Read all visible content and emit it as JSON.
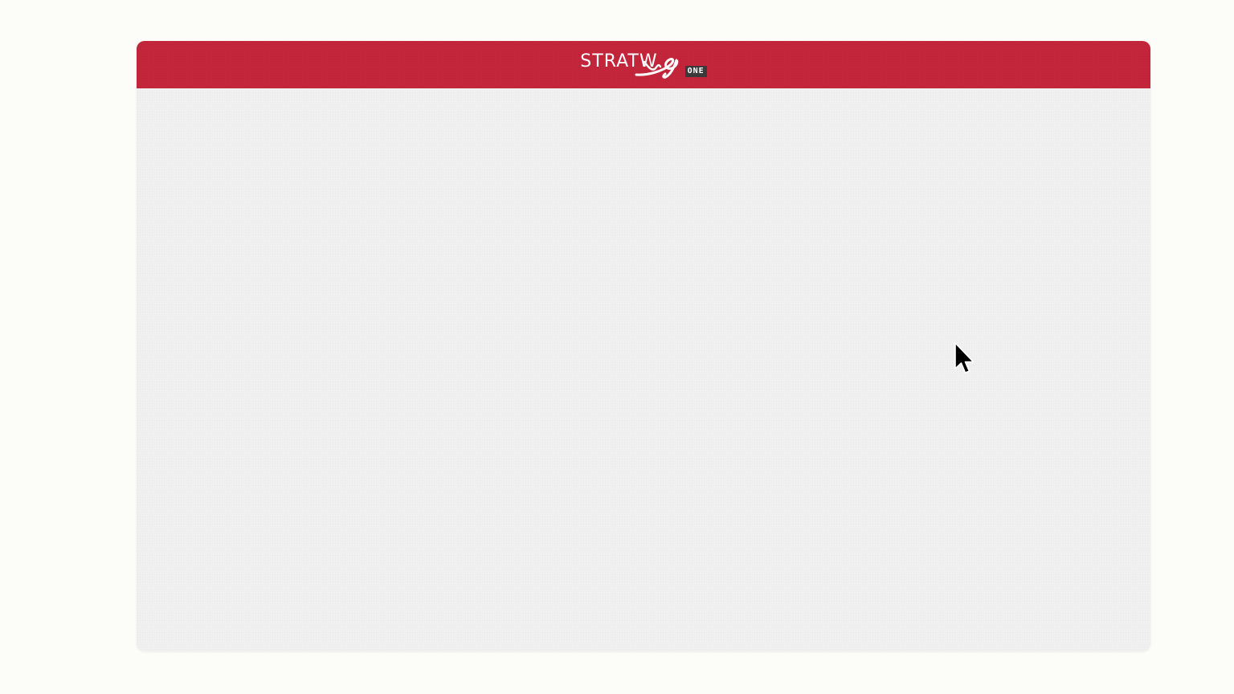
{
  "header": {
    "brand": {
      "wordmark": "STRATW",
      "badge": "ONE",
      "logo_icon": "stratws-swash-logo"
    },
    "color": "#c3253a"
  },
  "content": {
    "background": "#f0f0f0"
  },
  "page": {
    "background": "#fcfcf8"
  },
  "cursor": {
    "icon": "arrow-cursor-icon"
  }
}
